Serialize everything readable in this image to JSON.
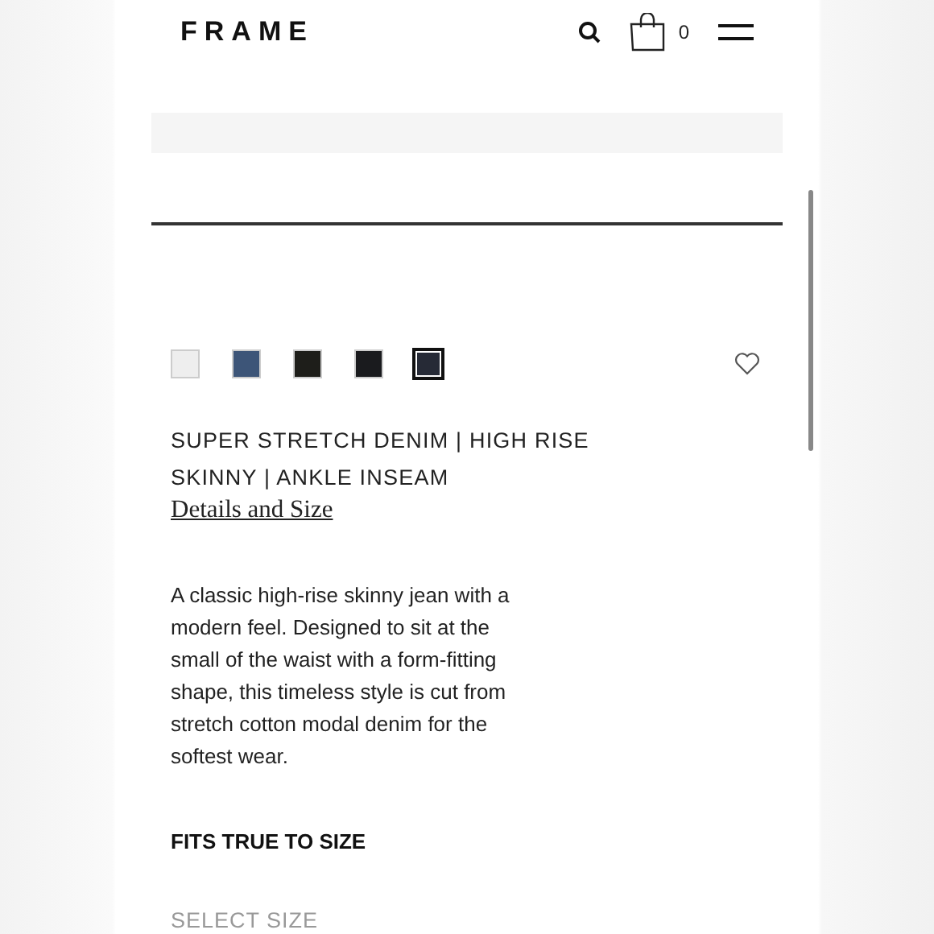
{
  "header": {
    "logo": "FRAME",
    "cart_count": "0"
  },
  "swatches": [
    {
      "color": "#eeeeee",
      "selected": false
    },
    {
      "color": "#3d5578",
      "selected": false
    },
    {
      "color": "#1e1e1a",
      "selected": false
    },
    {
      "color": "#1a1b1e",
      "selected": false
    },
    {
      "color": "#262a36",
      "selected": true
    }
  ],
  "product": {
    "title": "SUPER STRETCH DENIM | HIGH RISE SKINNY | ANKLE INSEAM",
    "details_link": "Details and Size",
    "description": "A classic high-rise skinny jean with a modern feel. Designed to sit at the small of the waist with a form-fitting shape, this timeless style is cut from stretch cotton modal denim for the softest wear.",
    "fit_note": "FITS TRUE TO SIZE",
    "size_label": "SELECT SIZE"
  }
}
